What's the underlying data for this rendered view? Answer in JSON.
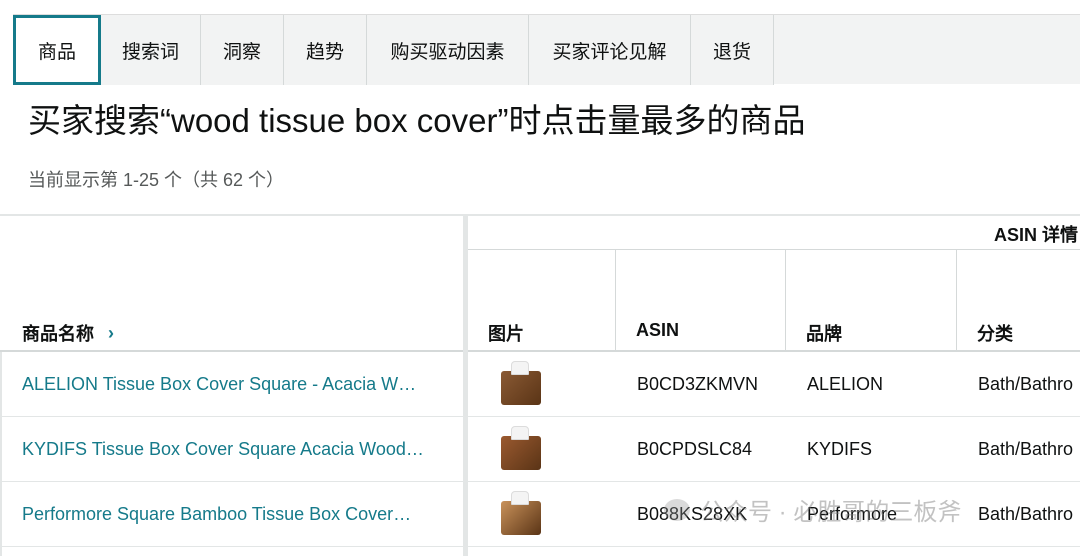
{
  "tabs": [
    {
      "label": "商品",
      "active": true
    },
    {
      "label": "搜索词",
      "active": false
    },
    {
      "label": "洞察",
      "active": false
    },
    {
      "label": "趋势",
      "active": false
    },
    {
      "label": "购买驱动因素",
      "active": false
    },
    {
      "label": "买家评论见解",
      "active": false
    },
    {
      "label": "退货",
      "active": false
    }
  ],
  "title": "买家搜索“wood tissue box cover”时点击量最多的商品",
  "result_count": "当前显示第 1-25 个（共 62 个）",
  "table": {
    "name_header": "商品名称",
    "group_header": "ASIN 详情",
    "columns": [
      "图片",
      "ASIN",
      "品牌",
      "分类"
    ],
    "rows": [
      {
        "name": "ALELION Tissue Box Cover Square - Acacia W…",
        "asin": "B0CD3ZKMVN",
        "brand": "ALELION",
        "category": "Bath/Bathro",
        "thumb_color": "#8a5a34"
      },
      {
        "name": "KYDIFS Tissue Box Cover Square Acacia Wood…",
        "asin": "B0CPDSLC84",
        "brand": "KYDIFS",
        "category": "Bath/Bathro",
        "thumb_color": "#9b5a30"
      },
      {
        "name": "Performore Square Bamboo Tissue Box Cover…",
        "asin": "B088KS28XK",
        "brand": "Performore",
        "category": "Bath/Bathro",
        "thumb_color": "#c9925a"
      }
    ]
  },
  "watermark": "公众号 · 必胜哥的三板斧",
  "colors": {
    "accent": "#157a8a",
    "tab_bg": "#f2f3f3"
  }
}
